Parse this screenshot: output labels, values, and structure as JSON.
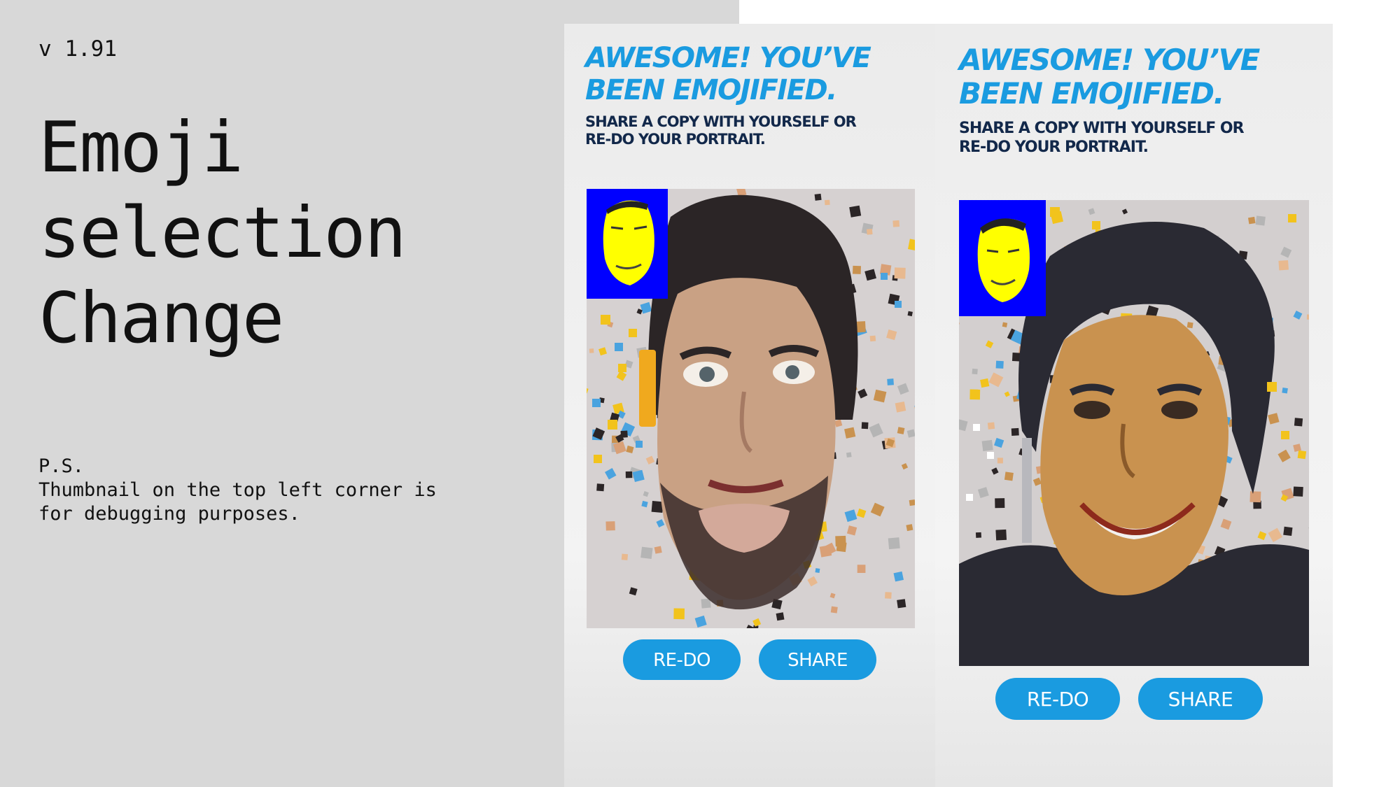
{
  "version": "v 1.91",
  "title_lines": [
    "Emoji",
    "selection",
    "Change"
  ],
  "note": {
    "line1": "P.S.",
    "line2": "Thumbnail on the top left corner is",
    "line3": "for debugging purposes."
  },
  "screens": [
    {
      "headline": [
        "AWESOME! YOU’VE",
        "BEEN EMOJIFIED."
      ],
      "subline": [
        "SHARE A COPY WITH YOURSELF OR",
        "RE-DO YOUR PORTRAIT."
      ],
      "redo_label": "RE-DO",
      "share_label": "SHARE",
      "portrait_icon": "emoji-mosaic-portrait-bearded-man",
      "thumbnail_icon": "yellow-face-thumbnail"
    },
    {
      "headline": [
        "AWESOME! YOU’VE",
        "BEEN EMOJIFIED."
      ],
      "subline": [
        "SHARE A COPY WITH YOURSELF OR",
        "RE-DO YOUR PORTRAIT."
      ],
      "redo_label": "RE-DO",
      "share_label": "SHARE",
      "portrait_icon": "emoji-mosaic-portrait-smiling-woman",
      "thumbnail_icon": "yellow-face-thumbnail"
    }
  ],
  "colors": {
    "accent": "#1a9be0",
    "subline": "#12284a",
    "thumbnail_bg": "#0000ff",
    "thumbnail_face": "#ffff00",
    "left_panel": "#d8d8d8"
  }
}
